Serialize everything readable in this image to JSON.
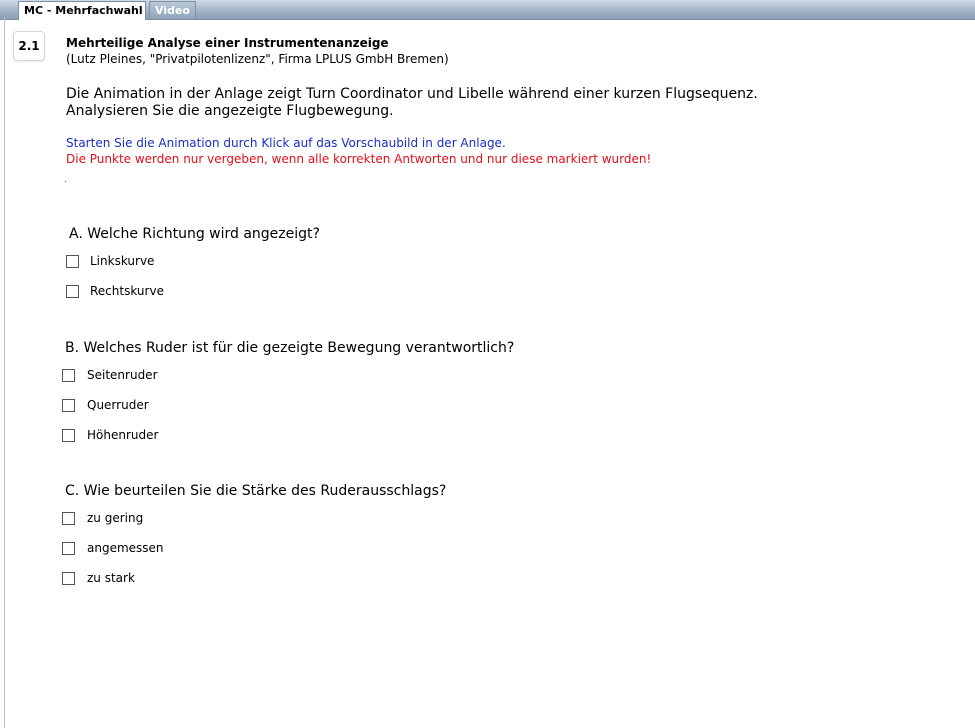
{
  "tabs": [
    {
      "label": "MC - Mehrfachwahl",
      "active": true
    },
    {
      "label": "Video",
      "active": false
    }
  ],
  "question": {
    "number": "2.1",
    "title": "Mehrteilige Analyse einer Instrumentenanzeige",
    "source": "(Lutz Pleines, \"Privatpilotenlizenz\", Firma LPLUS GmbH Bremen)",
    "intro_line1": "Die Animation in der Anlage zeigt Turn Coordinator und Libelle während einer kurzen Flugsequenz.",
    "intro_line2": "Analysieren Sie die angezeigte Flugbewegung.",
    "hint_blue": "Starten Sie die Animation durch Klick auf das Vorschaubild in der Anlage.",
    "hint_red": "Die Punkte werden nur vergeben, wenn alle korrekten Antworten und nur diese markiert wurden!"
  },
  "parts": [
    {
      "question": "A. Welche Richtung wird angezeigt?",
      "options": [
        "Linkskurve",
        "Rechtskurve"
      ]
    },
    {
      "question": "B. Welches Ruder ist für die gezeigte Bewegung verantwortlich?",
      "options": [
        "Seitenruder",
        "Querruder",
        "Höhenruder"
      ]
    },
    {
      "question": "C. Wie beurteilen Sie die Stärke des Ruderausschlags?",
      "options": [
        "zu gering",
        "angemessen",
        "zu stark"
      ]
    }
  ],
  "colors": {
    "hint_blue": "#1a2fc4",
    "hint_red": "#e0101a",
    "tabbar": "#9fb1c4"
  }
}
